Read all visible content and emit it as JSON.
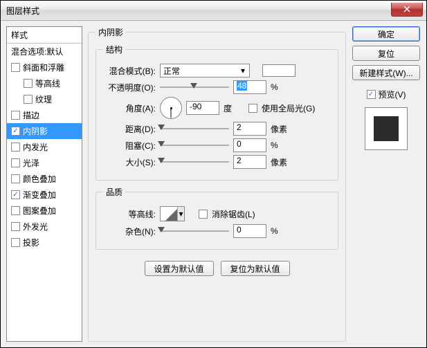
{
  "title": "图层样式",
  "sidebar": {
    "header": "样式",
    "blend_default": "混合选项:默认",
    "items": [
      {
        "label": "斜面和浮雕",
        "checked": false
      },
      {
        "label": "等高线",
        "checked": false,
        "child": true
      },
      {
        "label": "纹理",
        "checked": false,
        "child": true
      },
      {
        "label": "描边",
        "checked": false
      },
      {
        "label": "内阴影",
        "checked": true,
        "selected": true
      },
      {
        "label": "内发光",
        "checked": false
      },
      {
        "label": "光泽",
        "checked": false
      },
      {
        "label": "颜色叠加",
        "checked": false
      },
      {
        "label": "渐变叠加",
        "checked": true
      },
      {
        "label": "图案叠加",
        "checked": false
      },
      {
        "label": "外发光",
        "checked": false
      },
      {
        "label": "投影",
        "checked": false
      }
    ]
  },
  "panel_title": "内阴影",
  "structure": {
    "legend": "结构",
    "blend_mode_label": "混合模式(B):",
    "blend_mode_value": "正常",
    "opacity_label": "不透明度(O):",
    "opacity_value": "48",
    "opacity_unit": "%",
    "angle_label": "角度(A):",
    "angle_value": "-90",
    "angle_unit": "度",
    "global_light_label": "使用全局光(G)",
    "distance_label": "距离(D):",
    "distance_value": "2",
    "distance_unit": "像素",
    "choke_label": "阻塞(C):",
    "choke_value": "0",
    "choke_unit": "%",
    "size_label": "大小(S):",
    "size_value": "2",
    "size_unit": "像素"
  },
  "quality": {
    "legend": "品质",
    "contour_label": "等高线:",
    "antialias_label": "消除锯齿(L)",
    "noise_label": "杂色(N):",
    "noise_value": "0",
    "noise_unit": "%"
  },
  "buttons": {
    "set_default": "设置为默认值",
    "reset_default": "复位为默认值"
  },
  "right": {
    "ok": "确定",
    "cancel": "复位",
    "new_style": "新建样式(W)...",
    "preview_label": "预览(V)"
  }
}
